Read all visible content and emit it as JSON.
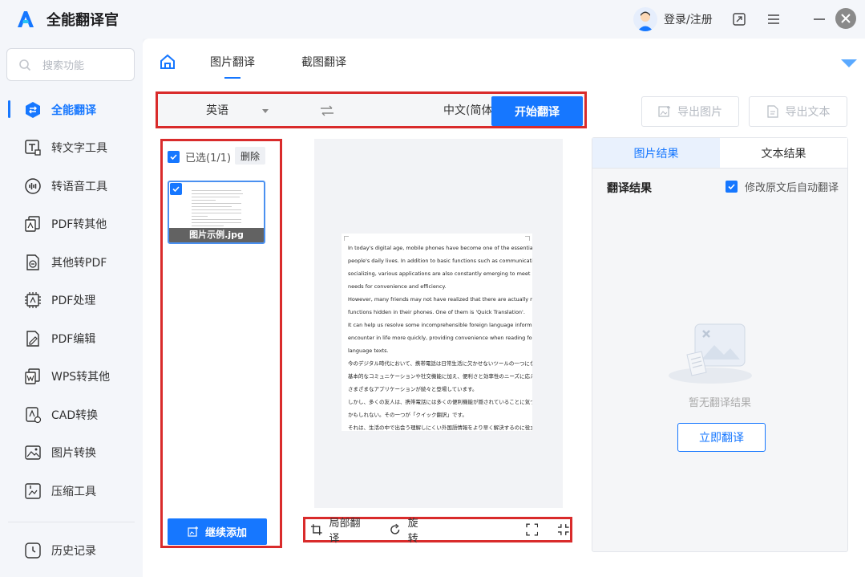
{
  "app": {
    "title": "全能翻译官"
  },
  "search": {
    "placeholder": "搜索功能"
  },
  "sidebar": {
    "items": [
      {
        "label": "全能翻译",
        "icon": "translate-icon"
      },
      {
        "label": "转文字工具",
        "icon": "text-tool-icon"
      },
      {
        "label": "转语音工具",
        "icon": "voice-tool-icon"
      },
      {
        "label": "PDF转其他",
        "icon": "pdf-convert-icon"
      },
      {
        "label": "其他转PDF",
        "icon": "to-pdf-icon"
      },
      {
        "label": "PDF处理",
        "icon": "pdf-process-icon"
      },
      {
        "label": "PDF编辑",
        "icon": "pdf-edit-icon"
      },
      {
        "label": "WPS转其他",
        "icon": "wps-icon"
      },
      {
        "label": "CAD转换",
        "icon": "cad-icon"
      },
      {
        "label": "图片转换",
        "icon": "image-convert-icon"
      },
      {
        "label": "压缩工具",
        "icon": "compress-icon"
      }
    ],
    "history": "历史记录"
  },
  "header": {
    "login": "登录/注册"
  },
  "main": {
    "tabs": [
      "图片翻译",
      "截图翻译"
    ],
    "source_lang": "英语",
    "target_lang": "中文(简体)",
    "start": "开始翻译",
    "export_image": "导出图片",
    "export_text": "导出文本"
  },
  "files": {
    "selected": "已选(1/1)",
    "delete": "删除",
    "thumb_name": "图片示例.jpg",
    "add": "继续添加"
  },
  "document": {
    "lines": [
      "In today's digital age, mobile phones have become one of the essential tools in",
      "people's daily lives. In addition to basic functions such as communication and",
      "socializing, various applications are also constantly emerging to meet people's",
      "needs for convenience and efficiency.",
      "However, many friends may not have realized that there are actually many fairy",
      "functions hidden in their phones. One of them is 'Quick Translation'.",
      "It can help us resolve some incomprehensible foreign language information we",
      "encounter in life more quickly, providing convenience when reading foreign",
      "language texts.",
      "今のデジタル時代において、携帯電話は日常生活に欠かせないツールの一つになっている。",
      "基本的なコミュニケーションや社交機能に加え、便利さと効率性のニーズに応えるために、",
      "さまざまなアプリケーションが続々と登場しています。",
      "しかし、多くの友人は、携帯電話には多くの便利機能が隠されていることに気づかない",
      "かもしれない。その一つが「クイック翻訳」です。",
      "それは、生活の中で出会う理解しにくい外国語情報をより早く解決するのに役立つ。"
    ]
  },
  "tools": {
    "partial": "局部翻译",
    "rotate": "旋转"
  },
  "result": {
    "tabs": [
      "图片结果",
      "文本结果"
    ],
    "title": "翻译结果",
    "auto": "修改原文后自动翻译",
    "empty": "暂无翻译结果",
    "now": "立即翻译"
  }
}
